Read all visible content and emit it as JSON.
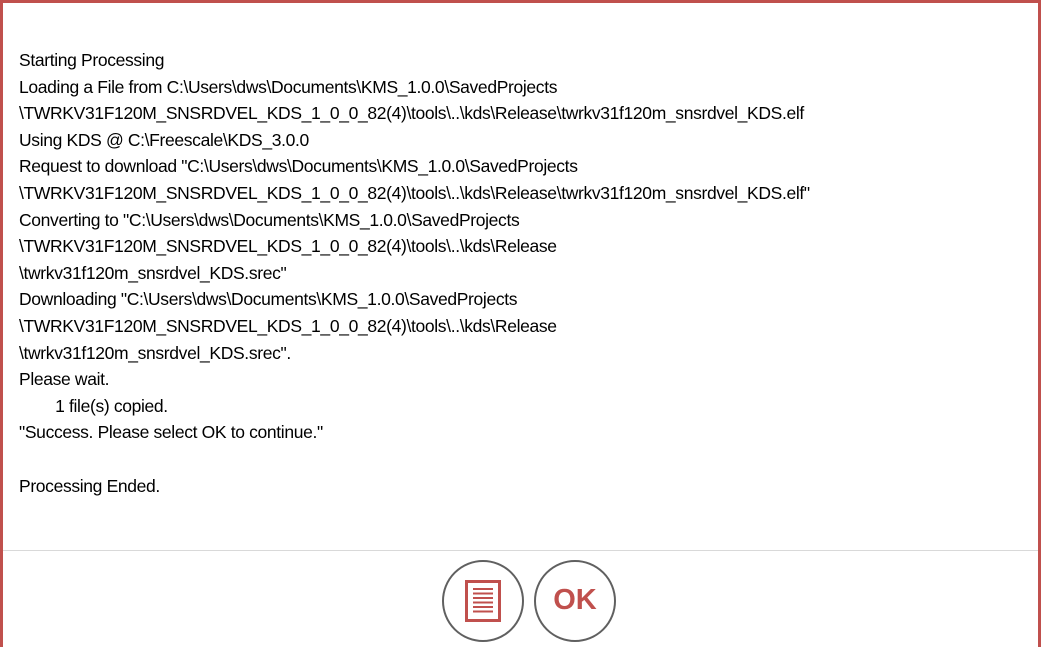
{
  "log": {
    "lines": [
      "Starting Processing",
      "Loading a File from C:\\Users\\dws\\Documents\\KMS_1.0.0\\SavedProjects",
      "\\TWRKV31F120M_SNSRDVEL_KDS_1_0_0_82(4)\\tools\\..\\kds\\Release\\twrkv31f120m_snsrdvel_KDS.elf",
      "Using KDS @ C:\\Freescale\\KDS_3.0.0",
      "Request to download \"C:\\Users\\dws\\Documents\\KMS_1.0.0\\SavedProjects",
      "\\TWRKV31F120M_SNSRDVEL_KDS_1_0_0_82(4)\\tools\\..\\kds\\Release\\twrkv31f120m_snsrdvel_KDS.elf\"",
      "Converting to \"C:\\Users\\dws\\Documents\\KMS_1.0.0\\SavedProjects",
      "\\TWRKV31F120M_SNSRDVEL_KDS_1_0_0_82(4)\\tools\\..\\kds\\Release",
      "\\twrkv31f120m_snsrdvel_KDS.srec\"",
      "Downloading \"C:\\Users\\dws\\Documents\\KMS_1.0.0\\SavedProjects",
      "\\TWRKV31F120M_SNSRDVEL_KDS_1_0_0_82(4)\\tools\\..\\kds\\Release",
      "\\twrkv31f120m_snsrdvel_KDS.srec\".",
      "Please wait.",
      "        1 file(s) copied.",
      "\"Success. Please select OK to continue.\"",
      "",
      "Processing Ended."
    ]
  },
  "buttons": {
    "log_icon": "document-list-icon",
    "ok_label": "OK"
  },
  "colors": {
    "accent": "#c0504d",
    "button_border": "#606060",
    "divider": "#d9d9d9"
  }
}
